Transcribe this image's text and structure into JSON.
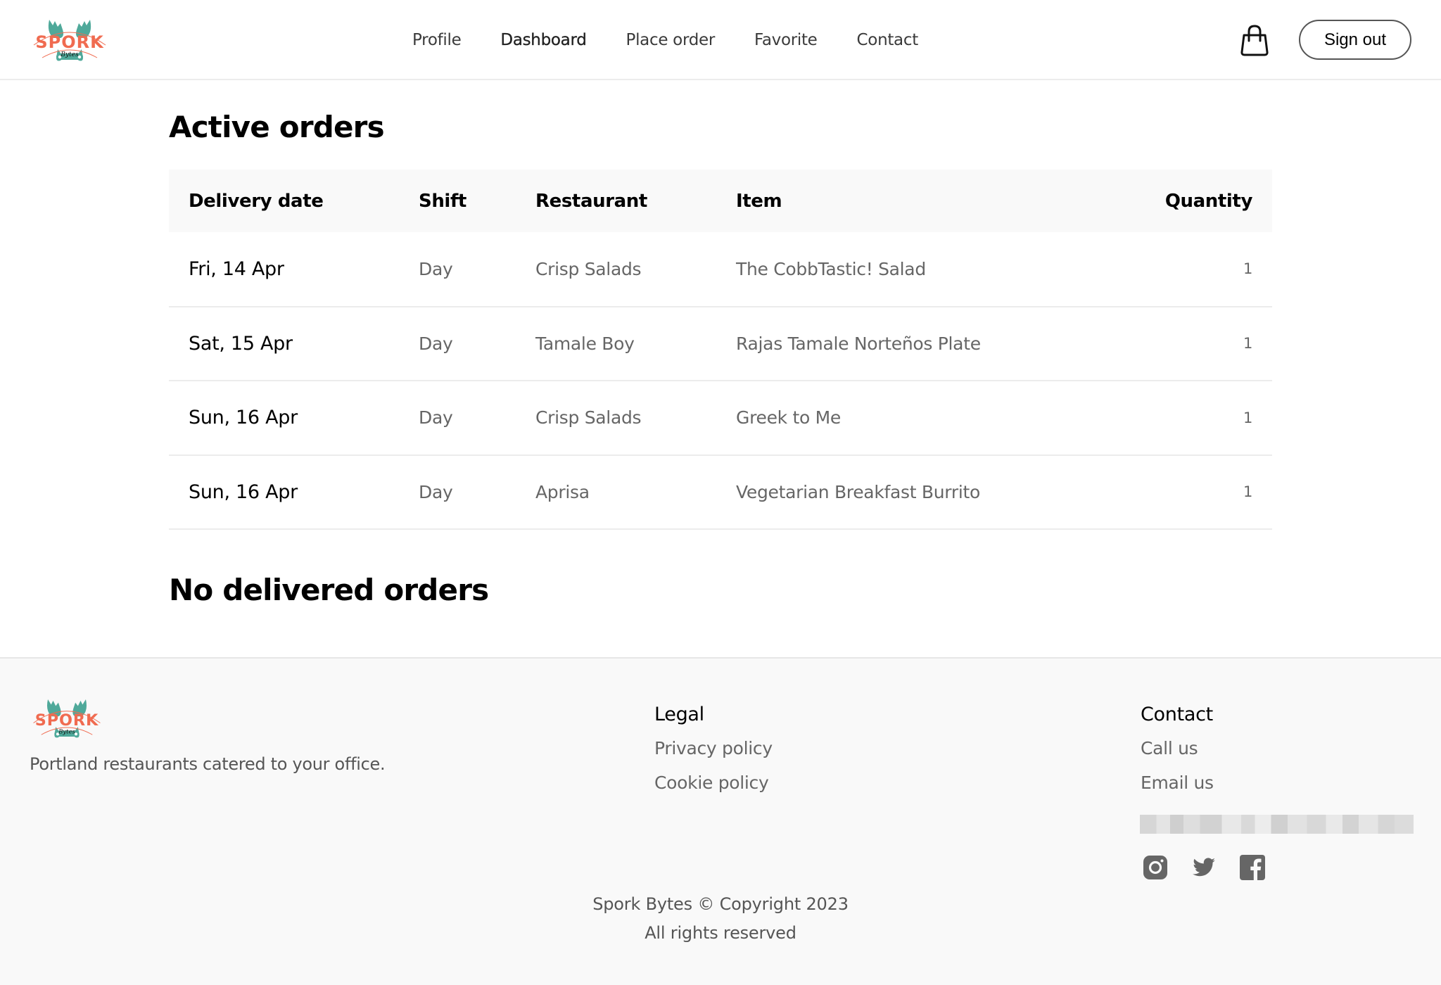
{
  "brand": {
    "name": "Spork Bytes",
    "logo_text": "SPORK",
    "logo_subtext": "Bytes",
    "colors": {
      "teal": "#4fa99a",
      "coral": "#f06b50"
    }
  },
  "header": {
    "nav": [
      {
        "label": "Profile",
        "active": false
      },
      {
        "label": "Dashboard",
        "active": true
      },
      {
        "label": "Place order",
        "active": false
      },
      {
        "label": "Favorite",
        "active": false
      },
      {
        "label": "Contact",
        "active": false
      }
    ],
    "cart_icon": "shopping-bag-icon",
    "signout_label": "Sign out"
  },
  "active_orders": {
    "title": "Active orders",
    "columns": [
      "Delivery date",
      "Shift",
      "Restaurant",
      "Item",
      "Quantity"
    ],
    "rows": [
      {
        "date": "Fri, 14 Apr",
        "shift": "Day",
        "restaurant": "Crisp Salads",
        "item": "The CobbTastic! Salad",
        "quantity": "1"
      },
      {
        "date": "Sat, 15 Apr",
        "shift": "Day",
        "restaurant": "Tamale Boy",
        "item": "Rajas Tamale Norteños Plate",
        "quantity": "1"
      },
      {
        "date": "Sun, 16 Apr",
        "shift": "Day",
        "restaurant": "Crisp Salads",
        "item": "Greek to Me",
        "quantity": "1"
      },
      {
        "date": "Sun, 16 Apr",
        "shift": "Day",
        "restaurant": "Aprisa",
        "item": "Vegetarian Breakfast Burrito",
        "quantity": "1"
      }
    ]
  },
  "delivered_orders": {
    "title": "No delivered orders"
  },
  "footer": {
    "tagline": "Portland restaurants catered to your office.",
    "legal": {
      "heading": "Legal",
      "links": [
        "Privacy policy",
        "Cookie policy"
      ]
    },
    "contact": {
      "heading": "Contact",
      "links": [
        "Call us",
        "Email us"
      ],
      "socials": [
        "instagram-icon",
        "twitter-icon",
        "facebook-icon"
      ]
    },
    "copyright": "Spork Bytes © Copyright 2023",
    "rights": "All rights reserved"
  }
}
